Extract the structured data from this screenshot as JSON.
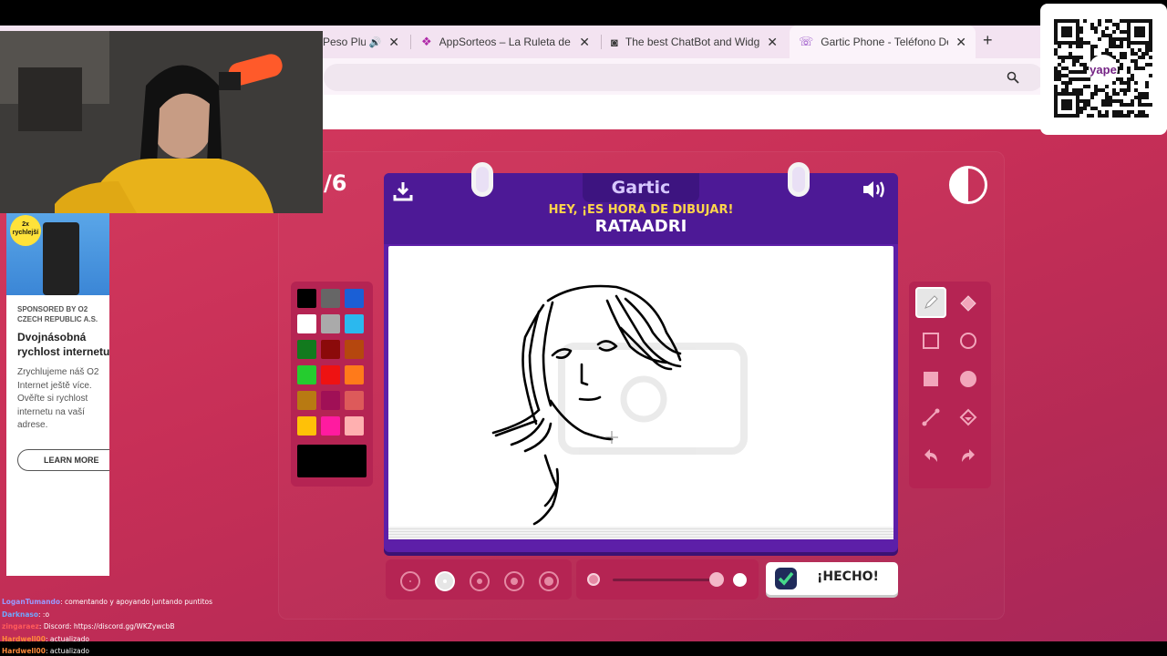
{
  "browser": {
    "tabs": [
      {
        "title": "Peso Plu",
        "active": false
      },
      {
        "title": "AppSorteos – La Ruleta de la",
        "active": false
      },
      {
        "title": "The best ChatBot and Widg",
        "active": false
      },
      {
        "title": "Gartic Phone - Teléfono Des",
        "active": true
      }
    ],
    "new_tab_label": "+"
  },
  "game": {
    "round_counter": "/6",
    "logo_text": "Gartic",
    "prompt": "HEY, ¡ES HORA DE DIBUJAR!",
    "player_name": "RATAADRI",
    "done_label": "¡HECHO!",
    "palette": [
      "#000000",
      "#666666",
      "#1a5fd6",
      "#ffffff",
      "#aaaaaa",
      "#2bb8ee",
      "#127a1e",
      "#8b0a0a",
      "#b5470e",
      "#25cc2f",
      "#ee1212",
      "#ff7a1a",
      "#b87a12",
      "#a01056",
      "#dd5a5a",
      "#ffc107",
      "#ff1ba0",
      "#ffb0b0"
    ],
    "current_color": "#000000",
    "brush_sizes": 5,
    "selected_brush": 1
  },
  "ad": {
    "sponsor": "SPONSORED BY O2 CZECH REPUBLIC A.S.",
    "title": "Dvojnásobná rychlost internetu",
    "body": "Zrychlujeme náš O2 Internet ještě více. Ověřte si rychlost internetu na vaší adrese.",
    "cta": "LEARN MORE",
    "badge": "2x rychlejší"
  },
  "qr": {
    "label": "yape"
  },
  "chat": [
    {
      "user": "LoganTumando",
      "text": ": comentando y apoyando juntando puntitos",
      "color": "#9a9aff"
    },
    {
      "user": "Darknaso",
      "text": ": :o",
      "color": "#6fa8ff"
    },
    {
      "user": "zingaraez",
      "text": ": Discord: https://discord.gg/WKZywcbB",
      "color": "#ff5a5a"
    },
    {
      "user": "Hardwell00",
      "text": ": actualizado",
      "color": "#ff8a3a"
    },
    {
      "user": "Hardwell00",
      "text": ": actualizado",
      "color": "#ff8a3a"
    }
  ]
}
